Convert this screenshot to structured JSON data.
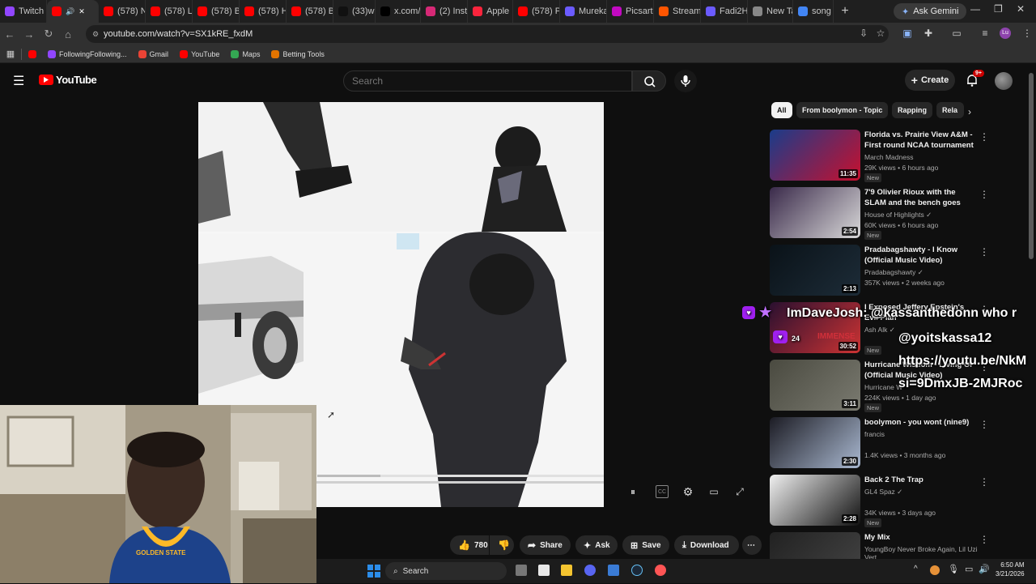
{
  "browser": {
    "tabs": [
      {
        "label": "Twitch",
        "color": "#9146ff"
      },
      {
        "label": "",
        "color": "#ff0000"
      },
      {
        "label": "(578) N",
        "color": "#ff0000"
      },
      {
        "label": "(578) Li",
        "color": "#ff0000"
      },
      {
        "label": "(578) B",
        "color": "#ff0000"
      },
      {
        "label": "(578) H",
        "color": "#ff0000"
      },
      {
        "label": "(578) B",
        "color": "#ff0000"
      },
      {
        "label": "(33)wh",
        "color": "#111111"
      },
      {
        "label": "x.com/i",
        "color": "#000000"
      },
      {
        "label": "(2) Inst",
        "color": "#d62976"
      },
      {
        "label": "Apple I",
        "color": "#fa243c"
      },
      {
        "label": "(578) P",
        "color": "#ff0000"
      },
      {
        "label": "Mureka",
        "color": "#6b5bff"
      },
      {
        "label": "Picsart",
        "color": "#c209c1"
      },
      {
        "label": "Stream",
        "color": "#ff5500"
      },
      {
        "label": "Fadi2H",
        "color": "#6b5bff"
      },
      {
        "label": "New Ta",
        "color": "#888888"
      },
      {
        "label": "song -",
        "color": "#4285f4"
      }
    ],
    "ask_gemini": "Ask Gemini",
    "url": "youtube.com/watch?v=SX1kRE_fxdM",
    "bookmarks": [
      {
        "label": "",
        "color": "#ff0000"
      },
      {
        "label": "FollowingFollowing...",
        "color": "#9146ff"
      },
      {
        "label": "Gmail",
        "color": "#ea4335"
      },
      {
        "label": "YouTube",
        "color": "#ff0000"
      },
      {
        "label": "Maps",
        "color": "#34a853"
      },
      {
        "label": "Betting Tools",
        "color": "#e37400"
      }
    ]
  },
  "youtube": {
    "logo": "YouTube",
    "search_placeholder": "Search",
    "create_label": "Create",
    "notif_count": "9+"
  },
  "chips": [
    "All",
    "From boolymon - Topic",
    "Rapping",
    "Rela"
  ],
  "actions": {
    "likes": "780",
    "share": "Share",
    "ask": "Ask",
    "save": "Save",
    "download": "Download"
  },
  "recommendations": [
    {
      "title": "Florida vs. Prairie View A&M - First round NCAA tournament ...",
      "channel": "March Madness",
      "meta": "29K views • 6 hours ago",
      "duration": "11:35",
      "new": "New"
    },
    {
      "title": "7'9 Olivier Rioux with the SLAM and the bench goes WILD 😂",
      "channel": "House of Highlights ✓",
      "meta": "60K views • 6 hours ago",
      "duration": "2:54",
      "new": "New"
    },
    {
      "title": "Pradabagshawty - I Know (Official Music Video)",
      "channel": "Pradabagshawty ✓",
      "meta": "357K views • 2 weeks ago",
      "duration": "2:13",
      "new": ""
    },
    {
      "title": "I Exposed Jeffery Epstein's Evil Plan",
      "channel": "Ash Alk ✓",
      "meta": "",
      "duration": "30:52",
      "new": "New"
    },
    {
      "title": "Hurricane Wisdom - Living Or (Official Music Video)",
      "channel": "Hurricane W",
      "meta": "224K views • 1 day ago",
      "duration": "3:11",
      "new": "New"
    },
    {
      "title": "boolymon - you wont (nine9)",
      "channel": "francis",
      "meta": "1.4K views • 3 months ago",
      "duration": "2:30",
      "new": ""
    },
    {
      "title": "Back 2 The Trap",
      "channel": "GL4 Spaz ✓",
      "meta": "34K views • 3 days ago",
      "duration": "2:28",
      "new": "New"
    },
    {
      "title": "My Mix",
      "channel": "YoungBoy Never Broke Again, Lil Uzi Vert...",
      "meta": "",
      "duration": "",
      "new": ""
    }
  ],
  "chat_overlay": {
    "line1": "ImDaveJosh: @kassanthedonn who r",
    "line2": "@yoitskassa12",
    "line3": "https://youtu.be/NkM",
    "line4": "si=9DmxJB-2MJRoc",
    "badge": "24",
    "red_text": "IMMENSE"
  },
  "taskbar": {
    "search_label": "Search",
    "time": "6:50 AM",
    "date": "3/21/2026"
  },
  "webcam": {
    "jersey_text": "GOLDEN STATE"
  }
}
